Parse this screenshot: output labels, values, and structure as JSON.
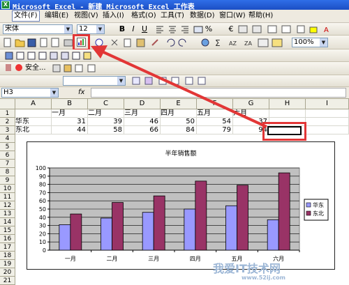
{
  "title_bar": {
    "icon_glyph": "X",
    "text": "Microsoft Excel - 新建 Microsoft Excel 工作表"
  },
  "menu": {
    "items": [
      "文件(F)",
      "编辑(E)",
      "视图(V)",
      "插入(I)",
      "格式(O)",
      "工具(T)",
      "数据(D)",
      "窗口(W)",
      "帮助(H)"
    ]
  },
  "format_toolbar": {
    "font_name": "宋体",
    "font_size": "12",
    "bold": "B",
    "italic": "I",
    "underline": "U",
    "percent": "%",
    "euro": "€"
  },
  "standard_toolbar": {
    "zoom": "100%"
  },
  "security_toolbar": {
    "security_label": "安全..."
  },
  "formula_bar": {
    "name_box": "H3",
    "fx": "fx",
    "content": ""
  },
  "sheet": {
    "columns": [
      "A",
      "B",
      "C",
      "D",
      "E",
      "F",
      "G",
      "H",
      "I"
    ],
    "rows": [
      [
        "",
        "一月",
        "二月",
        "三月",
        "四月",
        "五月",
        "六月",
        "",
        ""
      ],
      [
        "华东",
        "31",
        "39",
        "46",
        "50",
        "54",
        "37",
        "",
        ""
      ],
      [
        "东北",
        "44",
        "58",
        "66",
        "84",
        "79",
        "94",
        "",
        ""
      ]
    ],
    "row_numbers": [
      "1",
      "2",
      "3",
      "4",
      "5",
      "6",
      "7",
      "8",
      "9",
      "10",
      "11",
      "12",
      "13",
      "14",
      "15",
      "16",
      "17",
      "18",
      "19",
      "20",
      "21"
    ],
    "selected_cell": "H3"
  },
  "chart_data": {
    "type": "bar",
    "title": "半年销售额",
    "categories": [
      "一月",
      "二月",
      "三月",
      "四月",
      "五月",
      "六月"
    ],
    "series": [
      {
        "name": "华东",
        "values": [
          31,
          39,
          46,
          50,
          54,
          37
        ],
        "color": "#9999ff"
      },
      {
        "name": "东北",
        "values": [
          44,
          58,
          66,
          84,
          79,
          94
        ],
        "color": "#993366"
      }
    ],
    "ylim": [
      0,
      100
    ],
    "yticks": [
      "0",
      "10",
      "20",
      "30",
      "40",
      "50",
      "60",
      "70",
      "80",
      "90",
      "100"
    ],
    "grid": true,
    "plot_background": "#c0c0c0",
    "legend_position": "right"
  },
  "watermark": {
    "text": "我爱IT技术网",
    "url": "www.52ij.com"
  },
  "colors": {
    "accent_red": "#e23636",
    "selection": "#000000",
    "titlebar_blue": "#2f6ee8"
  }
}
